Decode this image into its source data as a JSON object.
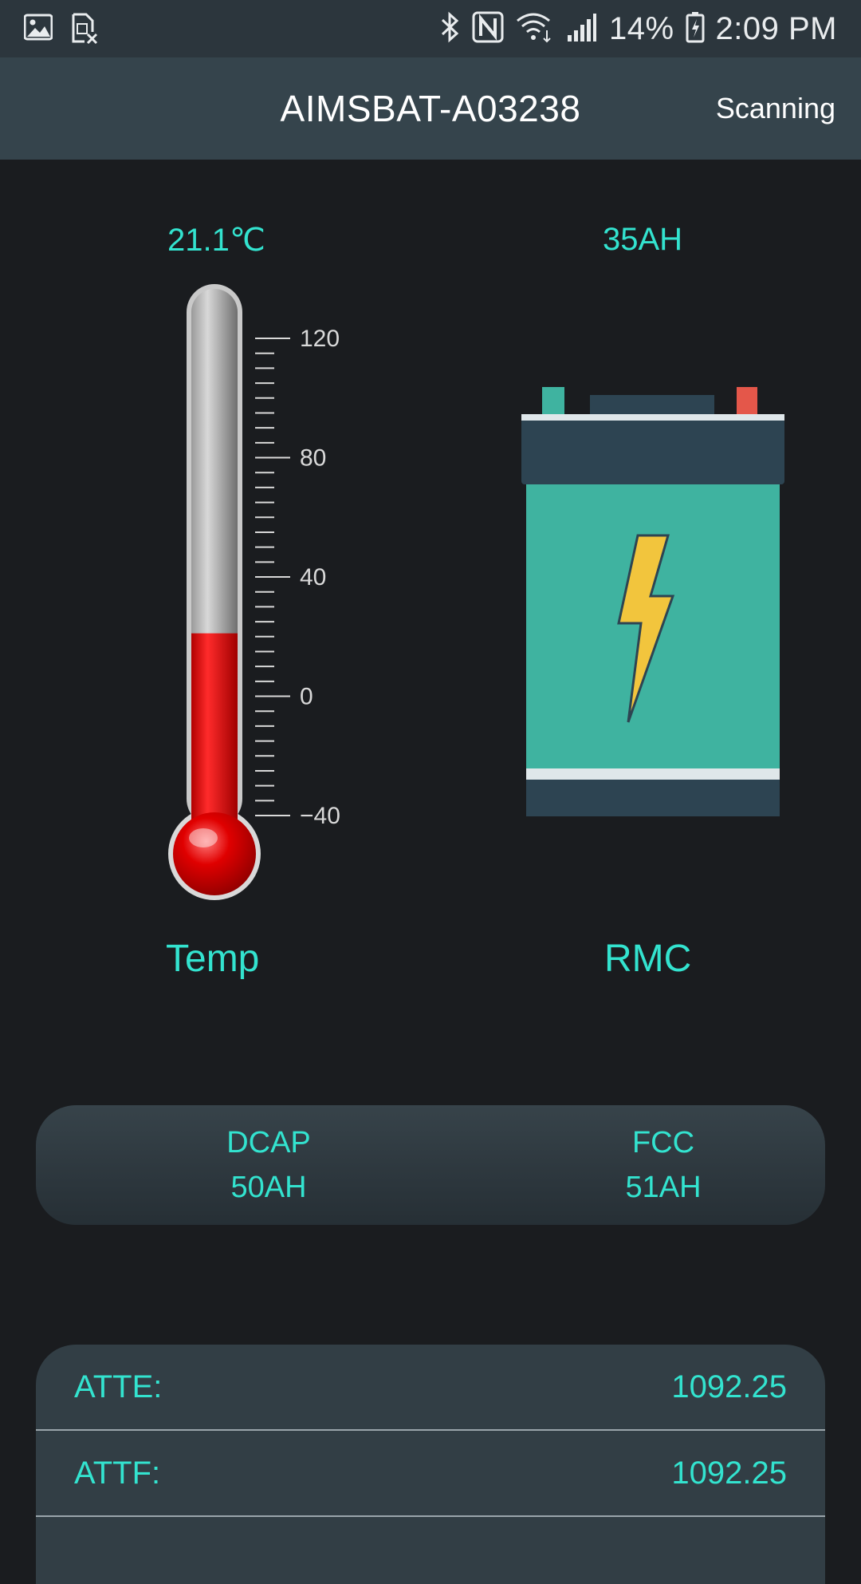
{
  "status_bar": {
    "battery_percent": "14%",
    "time": "2:09 PM",
    "icons": [
      "image-icon",
      "sim-x-icon",
      "bluetooth-icon",
      "nfc-icon",
      "wifi-icon",
      "signal-icon",
      "battery-icon"
    ]
  },
  "app_bar": {
    "title": "AIMSBAT-A03238",
    "action_label": "Scanning"
  },
  "gauges": {
    "temp": {
      "value": "21.1℃",
      "label": "Temp",
      "level_celsius": 21.1,
      "scale_ticks": [
        "120",
        "80",
        "40",
        "0",
        "−40"
      ]
    },
    "rmc": {
      "value": "35AH",
      "label": "RMC"
    }
  },
  "capacity": {
    "dcap": {
      "label": "DCAP",
      "value": "50AH"
    },
    "fcc": {
      "label": "FCC",
      "value": "51AH"
    }
  },
  "details": [
    {
      "key": "ATTE:",
      "value": "1092.25"
    },
    {
      "key": "ATTF:",
      "value": "1092.25"
    }
  ],
  "colors": {
    "accent": "#33e3cf",
    "background": "#1a1c1f",
    "app_bar": "#35444c",
    "battery_body": "#3fb3a0",
    "battery_dark": "#2d4452",
    "mercury": "#d40808"
  }
}
